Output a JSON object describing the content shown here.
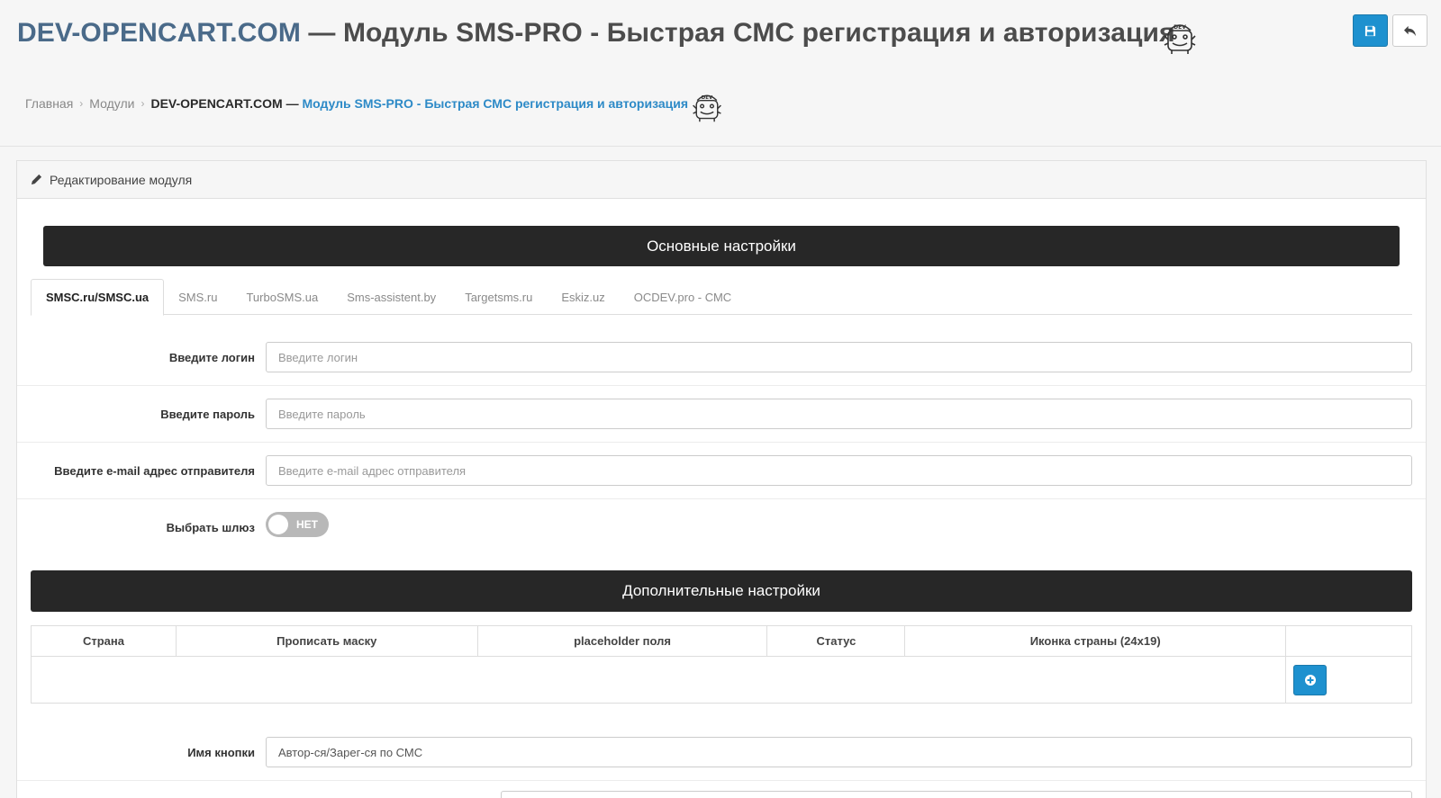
{
  "header": {
    "title_brand": "DEV-OPENCART.COM",
    "title_rest": " — Модуль SMS-PRO - Быстрая СМС регистрация и авторизация",
    "mascot_icon": "dev-mascot-icon",
    "save_icon": "save-icon",
    "back_icon": "reply-icon",
    "save_color": "#1e91cf"
  },
  "breadcrumb": {
    "home": "Главная",
    "modules": "Модули",
    "current_brand": "DEV-OPENCART.COM —",
    "current_rest": "Модуль SMS-PRO - Быстрая СМС регистрация и авторизация"
  },
  "panel": {
    "heading": "Редактирование модуля",
    "main_section": "Основные настройки",
    "extra_section": "Дополнительные настройки"
  },
  "tabs": [
    "SMSC.ru/SMSC.ua",
    "SMS.ru",
    "TurboSMS.ua",
    "Sms-assistent.by",
    "Targetsms.ru",
    "Eskiz.uz",
    "OCDEV.pro - СМС"
  ],
  "form": {
    "login_label": "Введите логин",
    "login_placeholder": "Введите логин",
    "login_value": "",
    "password_label": "Введите пароль",
    "password_placeholder": "Введите пароль",
    "password_value": "",
    "email_label": "Введите e-mail адрес отправителя",
    "email_placeholder": "Введите e-mail адрес отправителя",
    "email_value": "",
    "gateway_label": "Выбрать шлюз",
    "gateway_toggle": "НЕТ",
    "button_name_label": "Имя кнопки",
    "button_name_value": "Автор-ся/Зарег-ся по СМС"
  },
  "table": {
    "headers": [
      "Страна",
      "Прописать маску",
      "placeholder поля",
      "Статус",
      "Иконка страны (24x19)",
      ""
    ],
    "add_icon": "plus-circle-icon"
  }
}
